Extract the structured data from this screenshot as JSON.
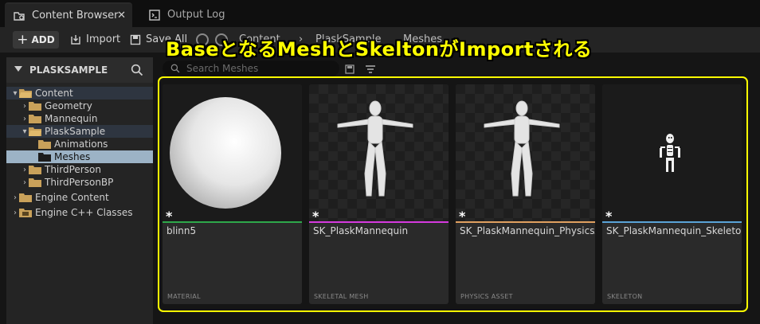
{
  "tabs": [
    {
      "label": "Content Browser",
      "icon": "content-browser-icon"
    },
    {
      "label": "Output Log",
      "icon": "output-log-icon"
    }
  ],
  "toolbar": {
    "add_label": "ADD",
    "import_label": "Import",
    "saveall_label": "Save All",
    "breadcrumb": [
      "Content",
      "PlaskSample",
      "Meshes"
    ]
  },
  "caption": "BaseとなるMeshとSkeltonがImportされる",
  "left_panel": {
    "title": "PLASKSAMPLE",
    "tree": [
      {
        "label": "Content"
      },
      {
        "label": "Geometry"
      },
      {
        "label": "Mannequin"
      },
      {
        "label": "PlaskSample"
      },
      {
        "label": "Animations"
      },
      {
        "label": "Meshes"
      },
      {
        "label": "ThirdPerson"
      },
      {
        "label": "ThirdPersonBP"
      },
      {
        "label": "Engine Content"
      },
      {
        "label": "Engine C++ Classes"
      }
    ]
  },
  "search": {
    "placeholder": "Search Meshes"
  },
  "assets": [
    {
      "name": "blinn5",
      "type": "MATERIAL",
      "color": "#2ea84a"
    },
    {
      "name": "SK_PlaskMannequin",
      "type": "SKELETAL MESH",
      "color": "#d63adf"
    },
    {
      "name": "SK_PlaskMannequin_PhysicsAsset",
      "type": "PHYSICS ASSET",
      "color": "#e0a060"
    },
    {
      "name": "SK_PlaskMannequin_Skeleton",
      "type": "SKELETON",
      "color": "#5aa3d8"
    }
  ],
  "colors": {
    "highlight": "#ffff00",
    "selected_folder": "#9cb3c6"
  }
}
